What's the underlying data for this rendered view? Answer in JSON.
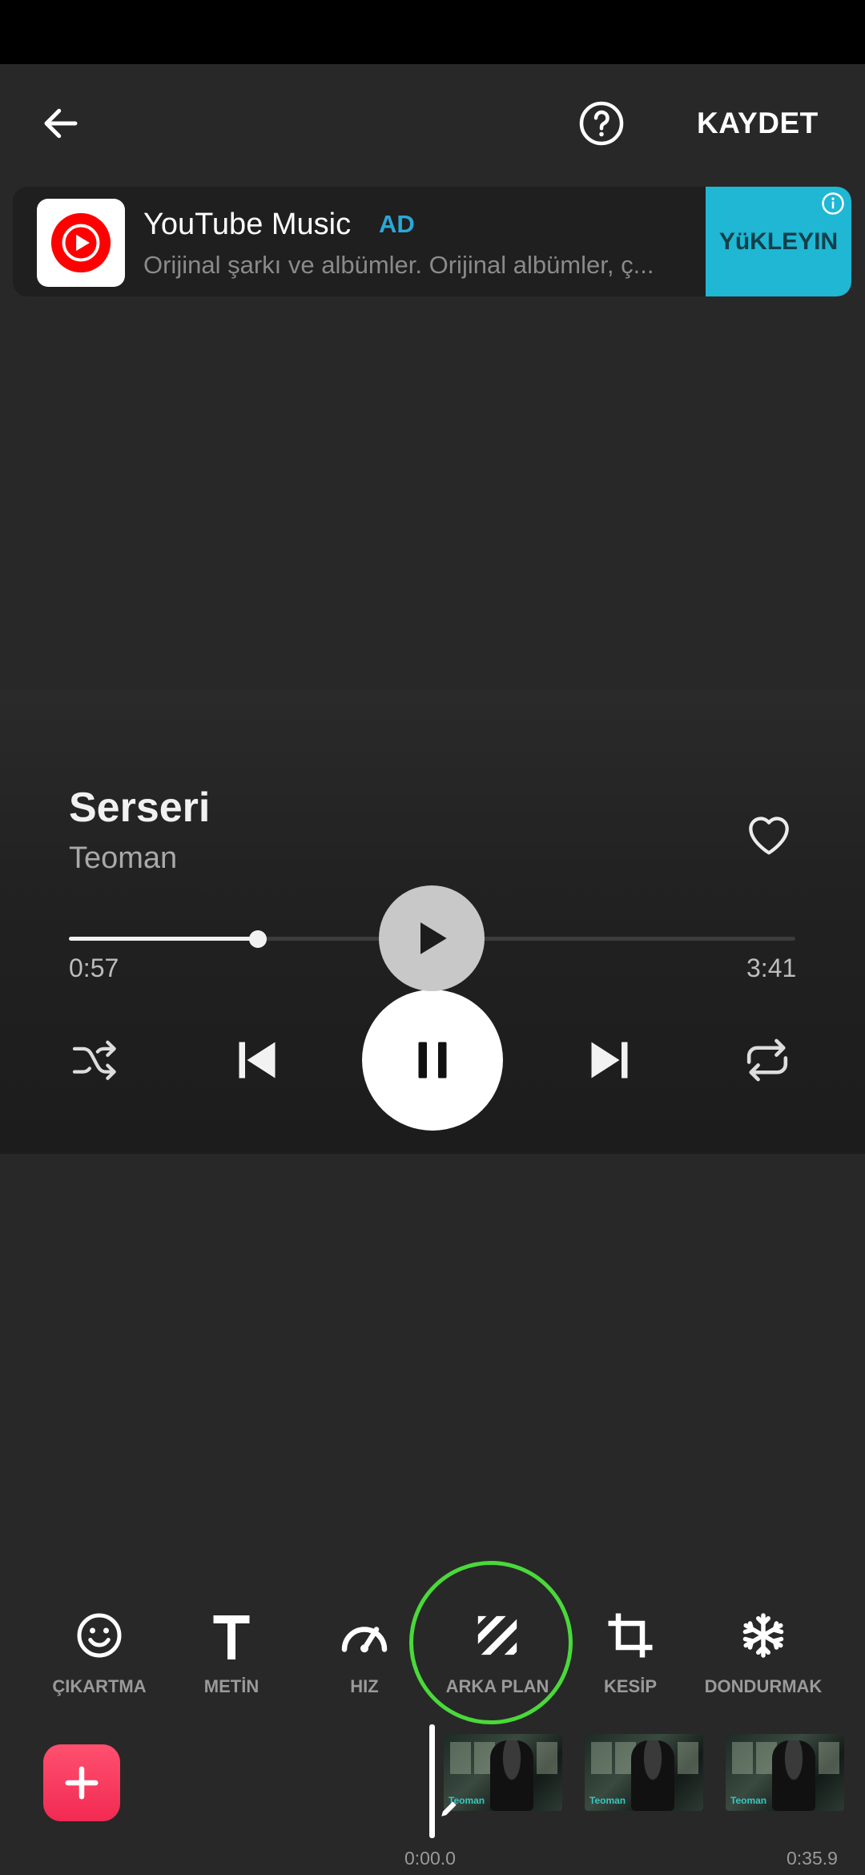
{
  "header": {
    "save_label": "KAYDET"
  },
  "ad": {
    "title": "YouTube Music",
    "badge": "AD",
    "description": "Orijinal şarkı ve albümler. Orijinal albümler, ç...",
    "cta": "YüKLEYIN",
    "accent": "#1fb7d4",
    "logo_color": "#ff0000"
  },
  "player": {
    "song_title": "Serseri",
    "artist": "Teoman",
    "elapsed": "0:57",
    "total": "3:41",
    "progress_fraction": 0.26
  },
  "toolbar": {
    "items": [
      {
        "label": "ÇIKARTMA",
        "icon": "smiley-icon"
      },
      {
        "label": "METİN",
        "icon": "text-icon"
      },
      {
        "label": "HIZ",
        "icon": "speedometer-icon"
      },
      {
        "label": "ARKA PLAN",
        "icon": "background-stripes-icon"
      },
      {
        "label": "KESİP",
        "icon": "crop-icon"
      },
      {
        "label": "DONDURMAK",
        "icon": "snowflake-icon"
      }
    ],
    "highlight_color": "#4ad93a"
  },
  "timeline": {
    "start": "0:00.0",
    "end": "0:35.9",
    "clip_caption": "Teoman"
  },
  "colors": {
    "background": "#282828",
    "add_button": "#f22a52"
  }
}
